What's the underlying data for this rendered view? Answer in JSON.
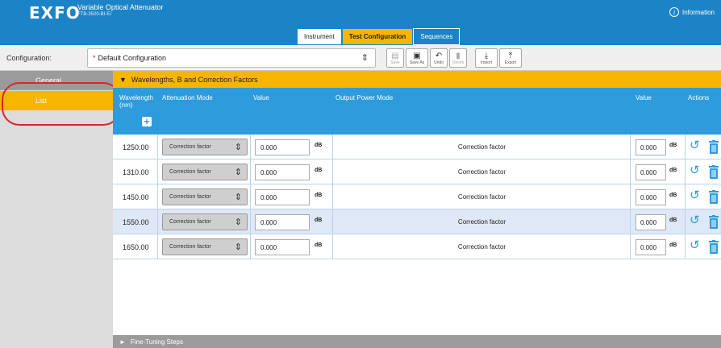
{
  "header": {
    "logo": "EXFO",
    "title": "Variable Optical Attenuator",
    "subtitle": "FTB-3500-BI-EI",
    "info_label": "Information",
    "tabs": [
      {
        "label": "Instrument"
      },
      {
        "label": "Test Configuration"
      },
      {
        "label": "Sequences"
      }
    ]
  },
  "config": {
    "label": "Configuration:",
    "value": "Default Configuration",
    "modified_marker": "*",
    "toolbar": {
      "save": "Save",
      "save_as": "Save As",
      "undo": "Undo",
      "delete": "Delete",
      "import": "Import",
      "export": "Export"
    }
  },
  "sidebar": {
    "items": [
      {
        "label": "General"
      },
      {
        "label": "List"
      }
    ]
  },
  "section": {
    "title": "Wavelengths, B and Correction Factors",
    "columns": {
      "wavelength": "Wavelength",
      "wavelength_unit": "(nm)",
      "attenuation_mode": "Attenuation Mode",
      "value": "Value",
      "output_power_mode": "Output Power Mode",
      "value2": "Value",
      "actions": "Actions"
    },
    "rows": [
      {
        "wavelength": "1250.00",
        "mode": "Correction factor",
        "value": "0.000",
        "unit": "dB",
        "output_mode": "Correction factor",
        "value2": "0.000",
        "unit2": "dB"
      },
      {
        "wavelength": "1310.00",
        "mode": "Correction factor",
        "value": "0.000",
        "unit": "dB",
        "output_mode": "Correction factor",
        "value2": "0.000",
        "unit2": "dB"
      },
      {
        "wavelength": "1450.00",
        "mode": "Correction factor",
        "value": "0.000",
        "unit": "dB",
        "output_mode": "Correction factor",
        "value2": "0.000",
        "unit2": "dB"
      },
      {
        "wavelength": "1550.00",
        "mode": "Correction factor",
        "value": "0.000",
        "unit": "dB",
        "output_mode": "Correction factor",
        "value2": "0.000",
        "unit2": "dB"
      },
      {
        "wavelength": "1650.00",
        "mode": "Correction factor",
        "value": "0.000",
        "unit": "dB",
        "output_mode": "Correction factor",
        "value2": "0.000",
        "unit2": "dB"
      }
    ]
  },
  "fine_tuning": {
    "title": "Fine-Tuning Steps"
  },
  "colors": {
    "header_blue": "#1c84c6",
    "accent_yellow": "#f7b500",
    "table_header_blue": "#2e9bdc",
    "annotation_red": "#d9262c"
  }
}
